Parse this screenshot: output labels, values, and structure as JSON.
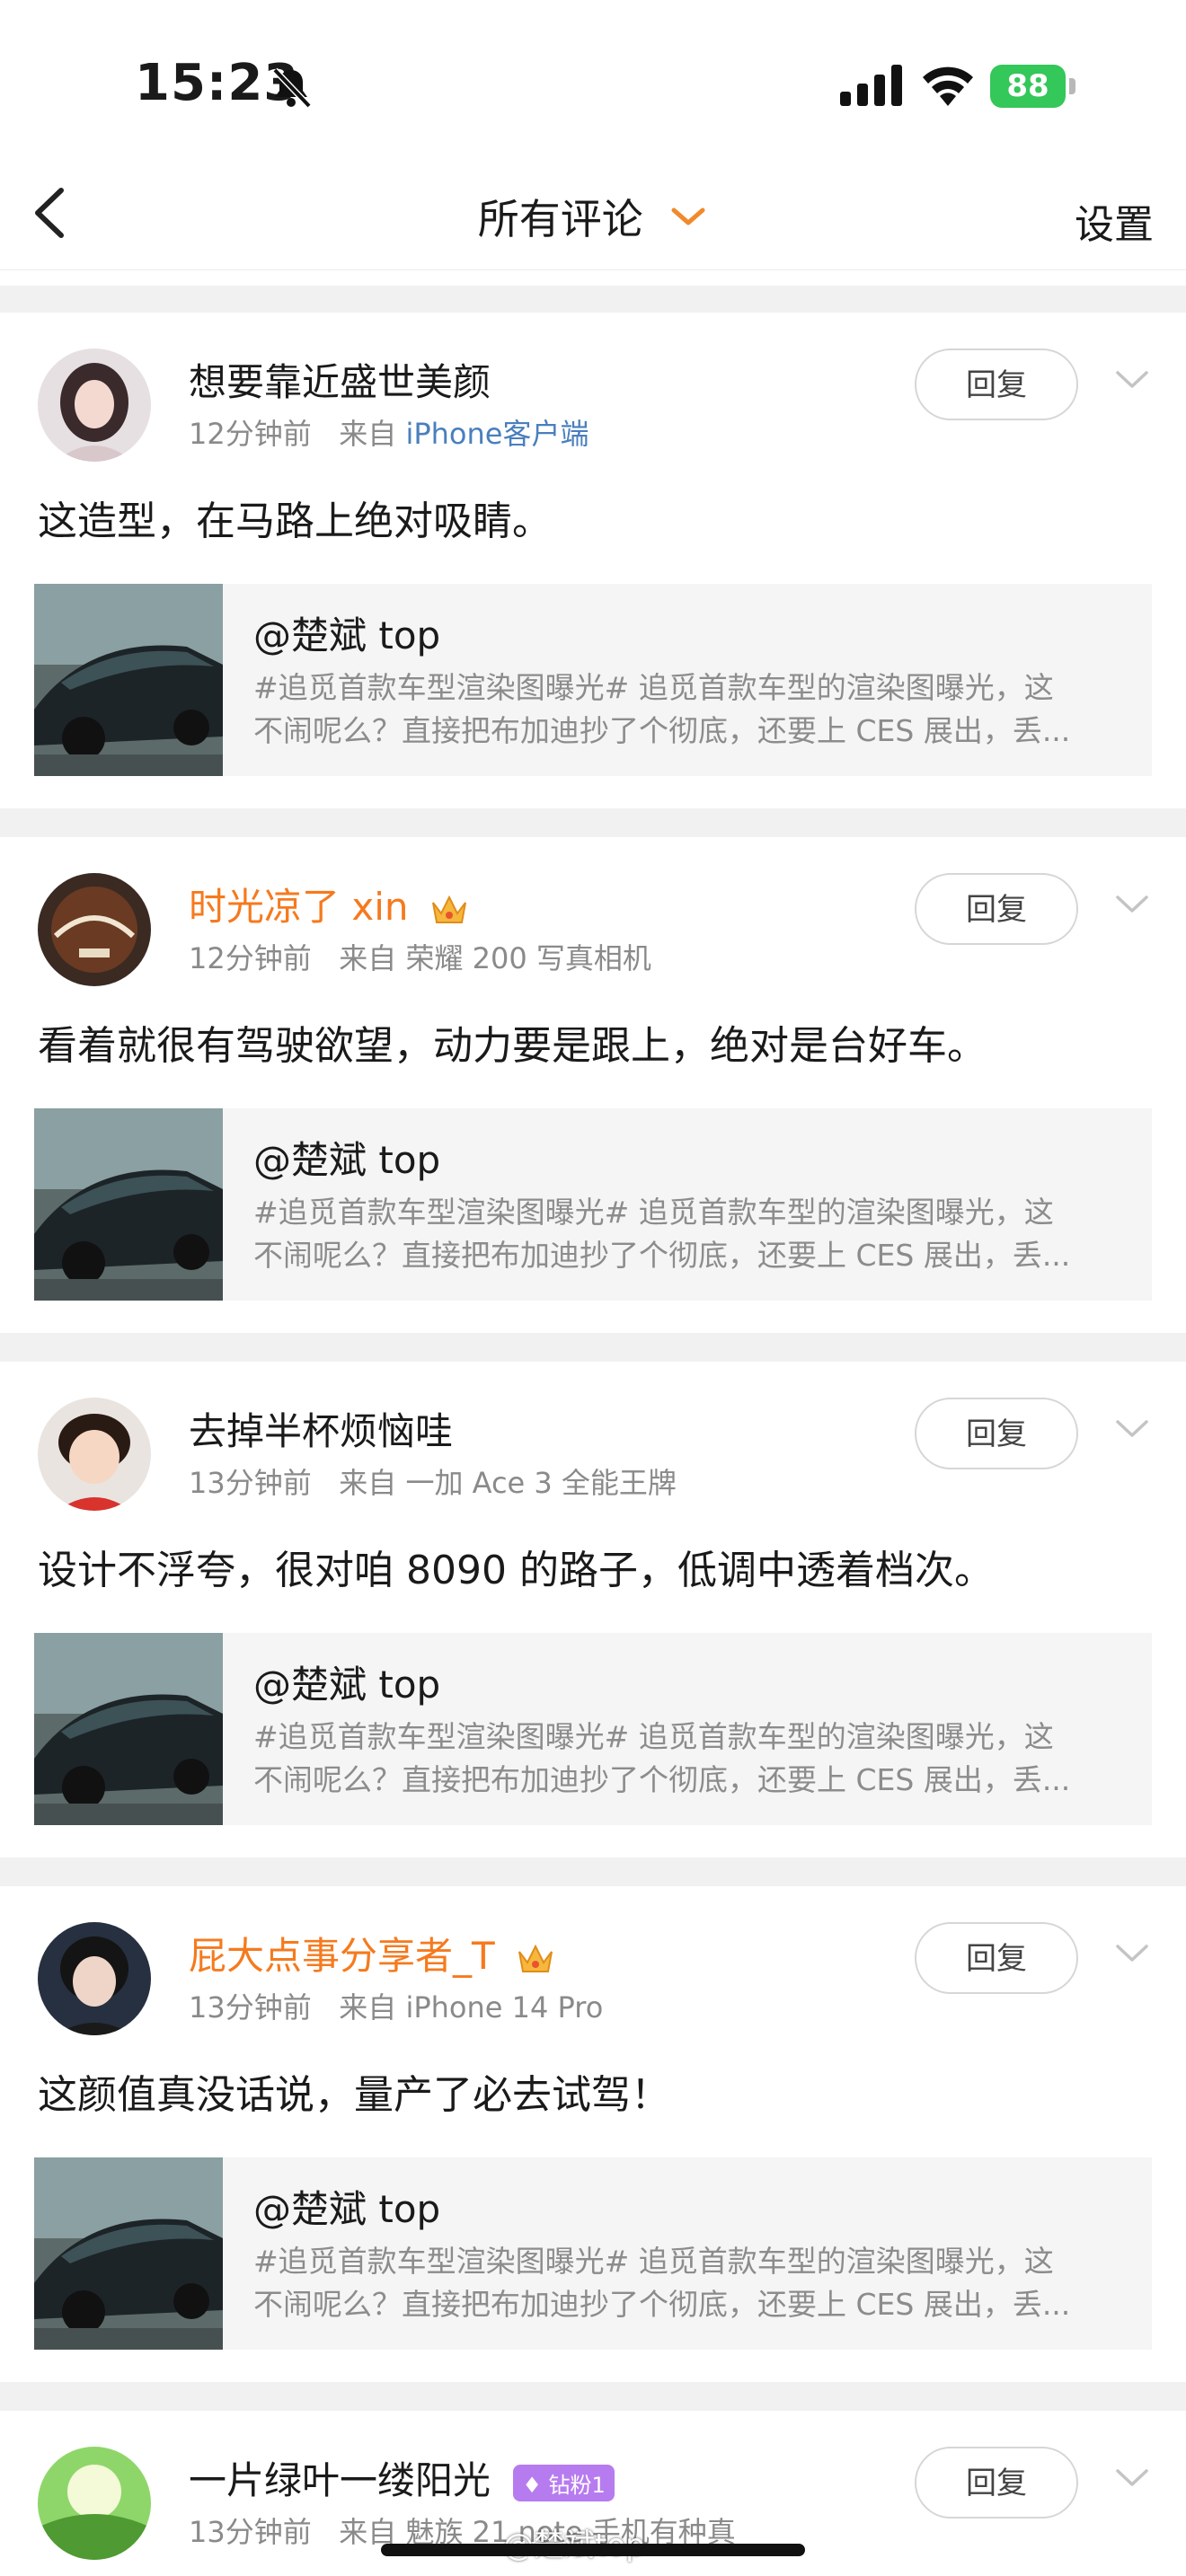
{
  "status_bar": {
    "time": "15:23",
    "battery": "88"
  },
  "nav": {
    "title": "所有评论",
    "settings": "设置"
  },
  "comments": [
    {
      "user": "想要靠近盛世美颜",
      "time": "12分钟前",
      "from": "来自",
      "source": "iPhone客户端",
      "text": "这造型，在马路上绝对吸睛。",
      "reply": "回复",
      "quote": {
        "author": "@楚斌 top",
        "line1": "#追觅首款车型渲染图曝光#  追觅首款车型的渲染图曝光，这",
        "line2": "不闹呢么？直接把布加迪抄了个彻底，还要上 CES 展出，丢..."
      }
    },
    {
      "user": "时光凉了 xin",
      "time": "12分钟前",
      "from": "来自",
      "source": "荣耀 200 写真相机",
      "text": "看着就很有驾驶欲望，动力要是跟上，绝对是台好车。",
      "reply": "回复",
      "quote": {
        "author": "@楚斌 top",
        "line1": "#追觅首款车型渲染图曝光#  追觅首款车型的渲染图曝光，这",
        "line2": "不闹呢么？直接把布加迪抄了个彻底，还要上 CES 展出，丢..."
      }
    },
    {
      "user": "去掉半杯烦恼哇",
      "time": "13分钟前",
      "from": "来自",
      "source": "一加 Ace 3 全能王牌",
      "text": "设计不浮夸，很对咱 8090 的路子，低调中透着档次。",
      "reply": "回复",
      "quote": {
        "author": "@楚斌 top",
        "line1": "#追觅首款车型渲染图曝光#  追觅首款车型的渲染图曝光，这",
        "line2": "不闹呢么？直接把布加迪抄了个彻底，还要上 CES 展出，丢..."
      }
    },
    {
      "user": "屁大点事分享者_T",
      "time": "13分钟前",
      "from": "来自",
      "source": "iPhone 14 Pro",
      "text": "这颜值真没话说，量产了必去试驾！",
      "reply": "回复",
      "quote": {
        "author": "@楚斌 top",
        "line1": "#追觅首款车型渲染图曝光#  追觅首款车型的渲染图曝光，这",
        "line2": "不闹呢么？直接把布加迪抄了个彻底，还要上 CES 展出，丢..."
      }
    },
    {
      "user": "一片绿叶一缕阳光",
      "badge": "钻粉1",
      "time": "13分钟前",
      "from": "来自",
      "source": "魅族 21 note 手机有种真",
      "reply": "回复"
    }
  ],
  "watermark": "@楚斌top",
  "colors": {
    "vip_name": "#f57a1e",
    "source_link": "#4a7fbd",
    "battery": "#34c759",
    "badge": "#b77bf0"
  }
}
